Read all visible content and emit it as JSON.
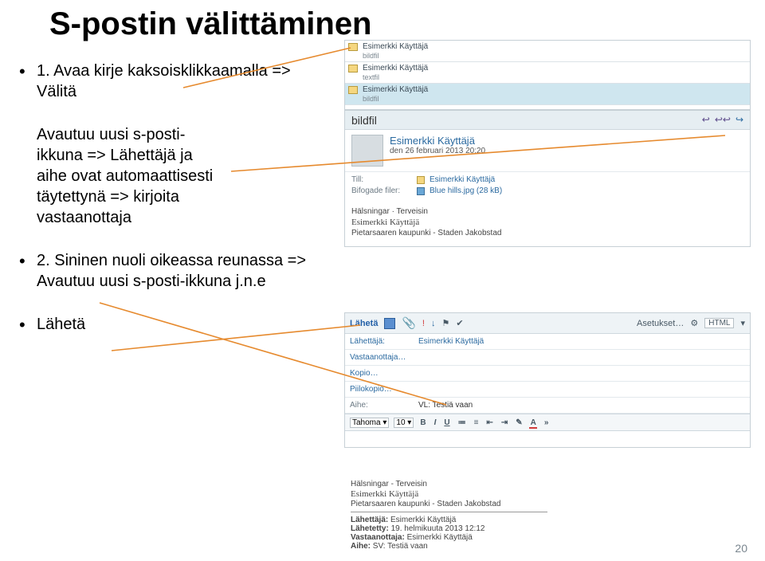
{
  "title": "S-postin välittäminen",
  "bullets": {
    "b1": "1. Avaa kirje kaksoisklikkaamalla => Välitä",
    "b2a": "Avautuu uusi s-posti-",
    "b2b": "ikkuna => Lähettäjä ja",
    "b2c": "aihe ovat automaattisesti",
    "b2d": "täytettynä => kirjoita",
    "b2e": "vastaanottaja",
    "b3": "2. Sininen nuoli oikeassa reunassa => Avautuu uusi s-posti-ikkuna j.n.e",
    "b4": "Lähetä"
  },
  "msglist": {
    "r0": {
      "name": "Esimerkki Käyttäjä",
      "sub": "bildfil"
    },
    "r1": {
      "name": "Esimerkki Käyttäjä",
      "sub": "textfil"
    },
    "r2": {
      "name": "Esimerkki Käyttäjä",
      "sub": "bildfil"
    }
  },
  "preview": {
    "subject": "bildfil",
    "from_name": "Esimerkki Käyttäjä",
    "from_date": "den 26 februari 2013 20:20",
    "to_lbl": "Till:",
    "att_lbl": "Bifogade filer:",
    "att_file": "Blue hills.jpg (28 kB)",
    "body_l1": "Hälsningar · Terveisin",
    "body_l2": "Esimerkki Käyttäjä",
    "body_l3": "Pietarsaaren kaupunki - Staden Jakobstad"
  },
  "compose": {
    "send": "Lähetä",
    "settings": "Asetukset…",
    "html": "HTML",
    "from_lbl": "Lähettäjä:",
    "from_val": "Esimerkki Käyttäjä",
    "to_lbl": "Vastaanottaja…",
    "cc_lbl": "Kopio…",
    "bcc_lbl": "Piilokopio…",
    "subj_lbl": "Aihe:",
    "subj_val": "VL: Testiä vaan",
    "font": "Tahoma",
    "size": "10"
  },
  "bottom": {
    "l1": "Hälsningar - Terveisin",
    "l2": "Esimerkki Käyttäjä",
    "l3": "Pietarsaaren kaupunki - Staden Jakobstad",
    "m1_l": "Lähettäjä:",
    "m1_v": "Esimerkki Käyttäjä",
    "m2_l": "Lähetetty:",
    "m2_v": "19. helmikuuta 2013 12:12",
    "m3_l": "Vastaanottaja:",
    "m3_v": "Esimerkki Käyttäjä",
    "m4_l": "Aihe:",
    "m4_v": "SV: Testiä vaan"
  },
  "page": "20"
}
